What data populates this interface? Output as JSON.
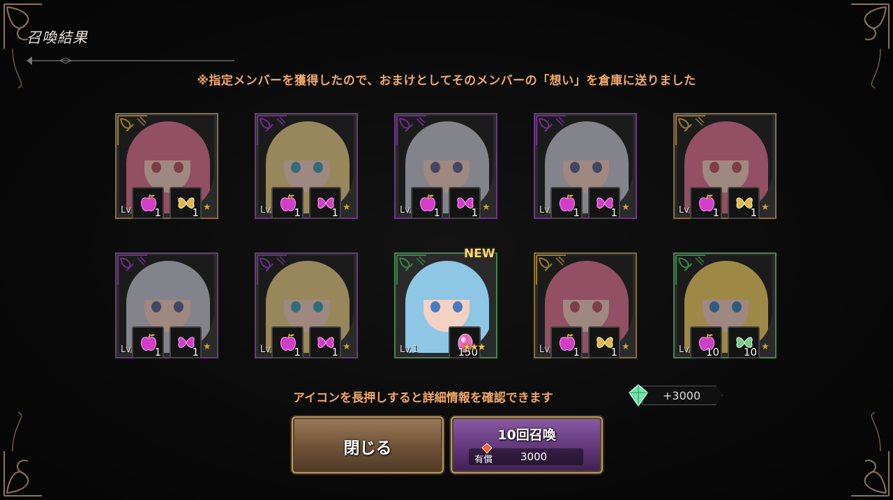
{
  "screen": {
    "title": "召喚結果",
    "notice": "※指定メンバーを獲得したので、おまけとしてそのメンバーの「想い」を倉庫に送りました",
    "hint": "アイコンを長押しすると詳細情報を確認できます",
    "gem_bonus": "+3000"
  },
  "results": [
    {
      "frame": "gold",
      "hair": "pink",
      "item1_icon": "apple-icon",
      "item1_count": "1",
      "item2_icon": "gold-butterfly-icon",
      "item2_count": "1",
      "lv": "Lv",
      "new": false
    },
    {
      "frame": "purple",
      "hair": "blonde",
      "item1_icon": "apple-icon",
      "item1_count": "1",
      "item2_icon": "purple-butterfly-icon",
      "item2_count": "1",
      "lv": "Lv",
      "new": false
    },
    {
      "frame": "purple",
      "hair": "silver",
      "item1_icon": "apple-icon",
      "item1_count": "1",
      "item2_icon": "purple-butterfly-icon",
      "item2_count": "1",
      "lv": "Lv",
      "new": false
    },
    {
      "frame": "purple",
      "hair": "silver",
      "item1_icon": "apple-icon",
      "item1_count": "1",
      "item2_icon": "purple-butterfly-icon",
      "item2_count": "1",
      "lv": "Lv",
      "new": false
    },
    {
      "frame": "gold",
      "hair": "pink",
      "item1_icon": "apple-icon",
      "item1_count": "1",
      "item2_icon": "gold-butterfly-icon",
      "item2_count": "1",
      "lv": "Lv",
      "new": false
    },
    {
      "frame": "purple",
      "hair": "silver",
      "item1_icon": "apple-icon",
      "item1_count": "1",
      "item2_icon": "purple-butterfly-icon",
      "item2_count": "1",
      "lv": "Lv",
      "new": false
    },
    {
      "frame": "purple",
      "hair": "blonde",
      "item1_icon": "apple-icon",
      "item1_count": "1",
      "item2_icon": "purple-butterfly-icon",
      "item2_count": "1",
      "lv": "Lv",
      "new": false
    },
    {
      "frame": "green",
      "hair": "blue",
      "item1_icon": "pink-egg-icon",
      "item1_count": "150",
      "lv": "Lv.1",
      "stars": "★★★",
      "new": true,
      "new_label": "NEW"
    },
    {
      "frame": "gold",
      "hair": "pink",
      "item1_icon": "apple-icon",
      "item1_count": "1",
      "item2_icon": "gold-butterfly-icon",
      "item2_count": "1",
      "lv": "Lv",
      "new": false
    },
    {
      "frame": "green",
      "hair": "yellow",
      "item1_icon": "apple-icon",
      "item1_count": "10",
      "item2_icon": "green-butterfly-icon",
      "item2_count": "10",
      "lv": "Lv",
      "new": false
    }
  ],
  "buttons": {
    "close_label": "閉じる",
    "summon_label": "10回召喚",
    "paid_label": "有償",
    "summon_cost": "3000"
  },
  "colors": {
    "accent_text": "#f1a86a",
    "gold_frame": "#8a6f34",
    "purple_frame": "#6a3a80",
    "green_frame": "#3f8a4a"
  }
}
